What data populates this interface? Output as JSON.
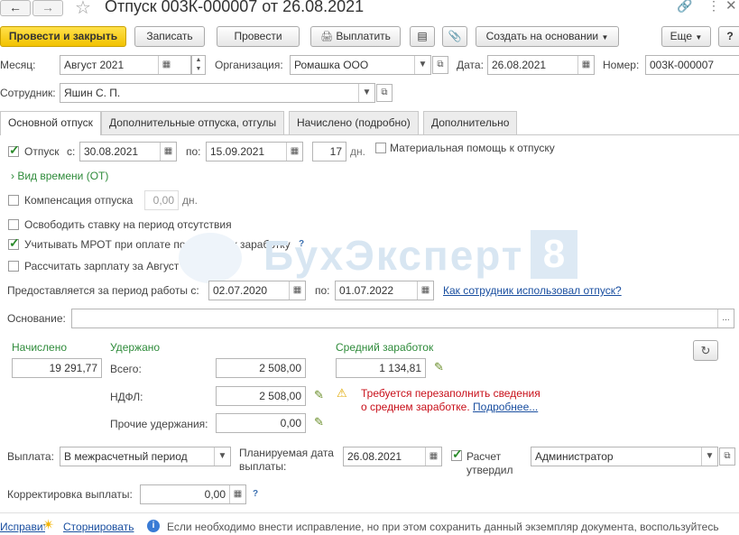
{
  "title": "Отпуск 003К-000007 от 26.08.2021",
  "toolbar": {
    "post_close": "Провести и закрыть",
    "save": "Записать",
    "post": "Провести",
    "pay": "Выплатить",
    "create_based": "Создать на основании",
    "more": "Еще",
    "help": "?"
  },
  "header": {
    "month_label": "Месяц:",
    "month_value": "Август 2021",
    "org_label": "Организация:",
    "org_value": "Ромашка ООО",
    "date_label": "Дата:",
    "date_value": "26.08.2021",
    "number_label": "Номер:",
    "number_value": "003К-000007",
    "employee_label": "Сотрудник:",
    "employee_value": "Яшин С. П."
  },
  "tabs": [
    "Основной отпуск",
    "Дополнительные отпуска, отгулы",
    "Начислено (подробно)",
    "Дополнительно"
  ],
  "vacation": {
    "label": "Отпуск",
    "from_label": "с:",
    "from": "30.08.2021",
    "to_label": "по:",
    "to": "15.09.2021",
    "days": "17",
    "days_label": "дн.",
    "material_help": "Материальная помощь к отпуску",
    "time_kind": "Вид времени (ОТ)",
    "compensation_label": "Компенсация отпуска",
    "compensation_value": "0,00",
    "compensation_unit": "дн.",
    "release_rate": "Освободить ставку на период отсутствия",
    "mrot": "Учитывать МРОТ при оплате по среднему заработку",
    "calc_salary": "Рассчитать зарплату за Август 2021",
    "period_label": "Предоставляется за период работы с:",
    "period_from": "02.07.2020",
    "period_to_label": "по:",
    "period_to": "01.07.2022",
    "period_link": "Как сотрудник использовал отпуск?",
    "basis_label": "Основание:",
    "basis_value": ""
  },
  "amounts": {
    "accrued_label": "Начислено",
    "accrued_value": "19 291,77",
    "withheld_label": "Удержано",
    "total_label": "Всего:",
    "total_value": "2 508,00",
    "ndfl_label": "НДФЛ:",
    "ndfl_value": "2 508,00",
    "other_label": "Прочие удержания:",
    "other_value": "0,00",
    "avg_label": "Средний заработок",
    "avg_value": "1 134,81",
    "warning_line1": "Требуется перезаполнить сведения",
    "warning_line2": "о среднем заработке.",
    "warning_link": "Подробнее..."
  },
  "payment": {
    "label": "Выплата:",
    "value": "В межрасчетный период",
    "planned_label_1": "Планируемая дата",
    "planned_label_2": "выплаты:",
    "planned_value": "26.08.2021",
    "approved_label_1": "Расчет",
    "approved_label_2": "утвердил",
    "approver": "Администратор",
    "adjust_label": "Корректировка выплаты:",
    "adjust_value": "0,00"
  },
  "footer": {
    "fix_link": "Исправить",
    "storno_link": "Сторнировать",
    "info_text": "Если необходимо внести исправление, но при этом сохранить данный экземпляр документа, воспользуйтесь"
  },
  "watermark": "БухЭксперт 8"
}
